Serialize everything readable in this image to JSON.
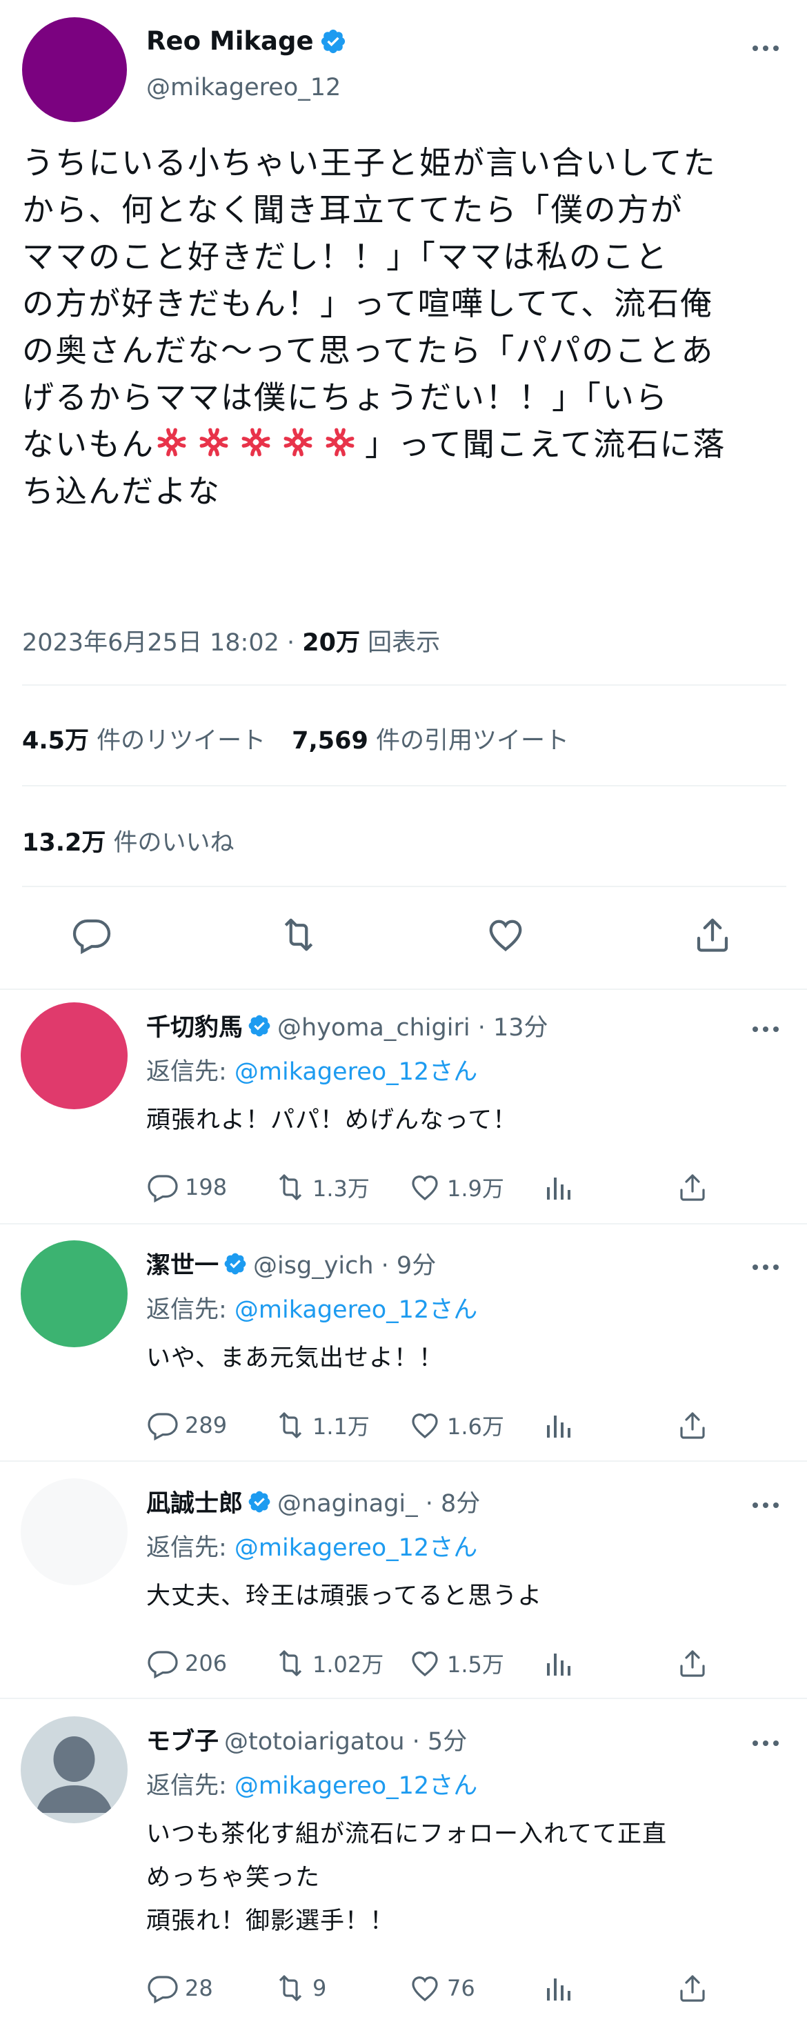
{
  "main_tweet": {
    "name": "Reo Mikage",
    "handle": "@mikagereo_12",
    "avatar_color": "#7b0280",
    "text_lines": [
      "うちにいる小ちゃい王子と姫が言い合いしてた",
      "から、何となく聞き耳立ててたら「僕の方が",
      "ママのこと好きだし！！」「ママは私のこと",
      "の方が好きだもん！」って喧嘩してて、流石俺",
      "の奥さんだな〜って思ってたら「パパのことあ",
      "げるからママは僕にちょうだい！！」「いら",
      "ないもん",
      "」って聞こえて流石に落",
      "ち込んだよな"
    ],
    "anger_emoji_count": 5,
    "timestamp": "2023年6月25日 18:02 · ",
    "views_count": "20万",
    "views_label": " 回表示",
    "retweets_count": "4.5万",
    "retweets_label": " 件のリツイート",
    "quotes_count": "7,569",
    "quotes_label": " 件の引用ツイート",
    "likes_count": "13.2万",
    "likes_label": " 件のいいね"
  },
  "replies": [
    {
      "name": "千切豹馬",
      "verified": true,
      "handle": "@hyoma_chigiri · 13分",
      "avatar_color": "#e03a6c",
      "reply_to_label": "返信先: ",
      "reply_to_user": "@mikagereo_12さん",
      "text_lines": [
        "頑張れよ！パパ！めげんなって！"
      ],
      "reply_count": "198",
      "retweet_count": "1.3万",
      "like_count": "1.9万"
    },
    {
      "name": "潔世一",
      "verified": true,
      "handle": "@isg_yich · 9分",
      "avatar_color": "#3cb371",
      "reply_to_label": "返信先: ",
      "reply_to_user": "@mikagereo_12さん",
      "text_lines": [
        "いや、まあ元気出せよ！！"
      ],
      "reply_count": "289",
      "retweet_count": "1.1万",
      "like_count": "1.6万"
    },
    {
      "name": "凪誠士郎",
      "verified": true,
      "handle": "@naginagi_ · 8分",
      "avatar_color": "#f7f8f9",
      "reply_to_label": "返信先: ",
      "reply_to_user": "@mikagereo_12さん",
      "text_lines": [
        "大丈夫、玲王は頑張ってると思うよ"
      ],
      "reply_count": "206",
      "retweet_count": "1.02万",
      "like_count": "1.5万"
    },
    {
      "name": "モブ子",
      "verified": false,
      "handle": "@totoiarigatou · 5分",
      "avatar_color": "#cfd9de",
      "reply_to_label": "返信先: ",
      "reply_to_user": "@mikagereo_12さん",
      "text_lines": [
        "いつも茶化す組が流石にフォロー入れてて正直",
        "めっちゃ笑った",
        "頑張れ！御影選手！！"
      ],
      "reply_count": "28",
      "retweet_count": "9",
      "like_count": "76"
    }
  ],
  "colors": {
    "accent": "#1d9bf0",
    "secondary_text": "#536471",
    "primary_text": "#0f1419",
    "divider": "#eff3f4",
    "anger_emoji": "#e8334a"
  },
  "icons": [
    "verified-badge-icon",
    "more-icon",
    "reply-icon",
    "retweet-icon",
    "like-icon",
    "share-icon",
    "views-icon",
    "anger-emoji-icon",
    "default-avatar-icon"
  ]
}
